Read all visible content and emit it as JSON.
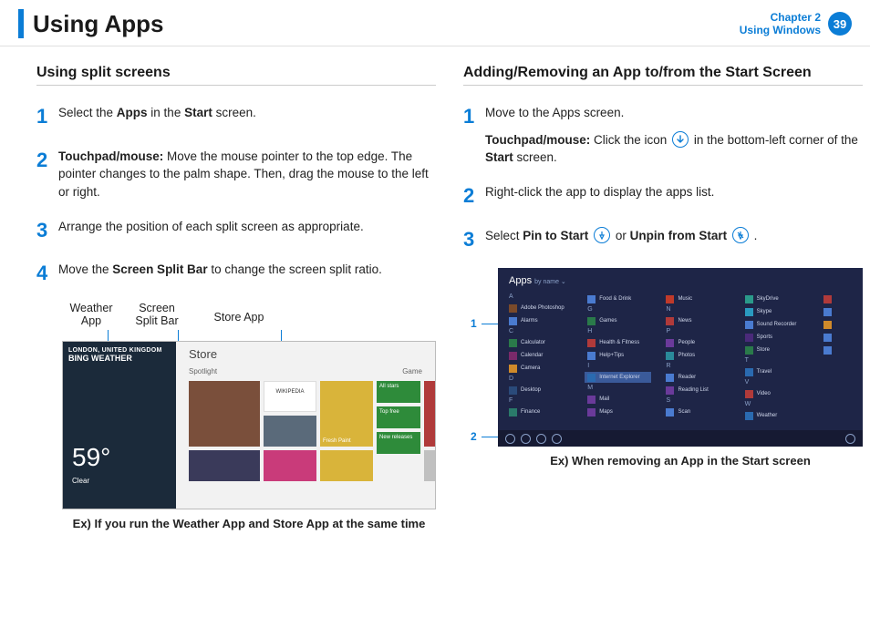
{
  "header": {
    "title": "Using Apps",
    "chapter_line1": "Chapter 2",
    "chapter_line2": "Using Windows",
    "page": "39"
  },
  "left": {
    "subhead": "Using split screens",
    "step1_a": "Select the ",
    "step1_b": "Apps",
    "step1_c": " in the ",
    "step1_d": "Start",
    "step1_e": " screen.",
    "step2_a": "Touchpad/mouse:",
    "step2_b": " Move the mouse pointer to the top edge. The pointer changes to the palm shape. Then, drag the mouse to the left or right.",
    "step3": "Arrange the position of each split screen as appropriate.",
    "step4_a": "Move the ",
    "step4_b": "Screen Split Bar",
    "step4_c": " to change the screen split ratio.",
    "label_weather_1": "Weather",
    "label_weather_2": "App",
    "label_split_1": "Screen",
    "label_split_2": "Split Bar",
    "label_store": "Store App",
    "shot1": {
      "loc": "LONDON, UNITED KINGDOM",
      "brand": "BING WEATHER",
      "temp": "59°",
      "cond": "Clear",
      "store_title": "Store",
      "spotlight": "Spotlight",
      "games": "Game",
      "wikipedia": "WIKIPEDIA",
      "allstars": "All stars",
      "fresh": "Fresh Paint",
      "toptree": "Top free",
      "newrel": "New releases"
    },
    "caption": "Ex) If you run the Weather App and Store App at the same time"
  },
  "right": {
    "subhead": "Adding/Removing an App to/from the Start Screen",
    "step1_a": "Move to the Apps screen.",
    "step1_b": "Touchpad/mouse:",
    "step1_c": " Click the icon ",
    "step1_d": " in the bottom-left corner of the ",
    "step1_e": "Start",
    "step1_f": " screen.",
    "step2": "Right-click the app to display the apps list.",
    "step3_a": "Select ",
    "step3_b": "Pin to Start",
    "step3_c": " or ",
    "step3_d": "Unpin from Start",
    "step3_e": " .",
    "shot2": {
      "title": "Apps",
      "callout1": "1",
      "callout2": "2"
    },
    "caption": "Ex) When removing an App in the Start screen"
  }
}
